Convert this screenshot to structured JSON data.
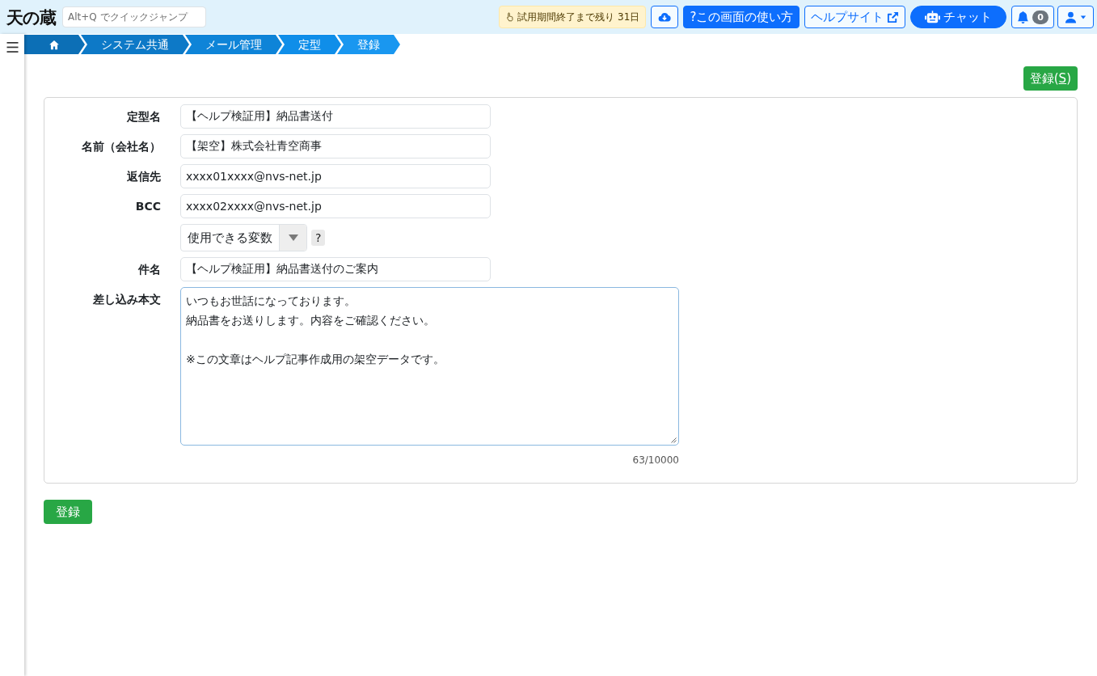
{
  "header": {
    "logo": "天の蔵",
    "quick_jump": {
      "placeholder": "Alt+Q でクイックジャンプ"
    },
    "trial_notice": "試用期間終了まで残り 31日",
    "actions": [
      {
        "kind": "download"
      },
      {
        "kind": "help",
        "label": "?この画面の使い方"
      },
      {
        "kind": "help_site",
        "label": "ヘルプサイト"
      },
      {
        "kind": "chat",
        "label": "チャット"
      },
      {
        "kind": "notifications",
        "count": "0"
      },
      {
        "kind": "user_menu"
      }
    ]
  },
  "breadcrumb": [
    {
      "kind": "home"
    },
    {
      "kind": "link",
      "label": "システム共通"
    },
    {
      "kind": "link",
      "label": "メール管理"
    },
    {
      "kind": "link",
      "label": "定型"
    },
    {
      "kind": "link",
      "label": "登録"
    }
  ],
  "toolbar": {
    "save_button": {
      "label": "登録(",
      "access_key": "S",
      "label_end": ")"
    }
  },
  "form": {
    "fields": [
      {
        "kind": "text",
        "label": "定型名",
        "value": "【ヘルプ検証用】納品書送付"
      },
      {
        "kind": "text",
        "label": "名前（会社名）",
        "value": "【架空】株式会社青空商事"
      },
      {
        "kind": "text",
        "label": "返信先",
        "value": "xxxx01xxxx@nvs-net.jp"
      },
      {
        "kind": "text",
        "label": "BCC",
        "value": "xxxx02xxxx@nvs-net.jp"
      },
      {
        "kind": "select",
        "value": "使用できる変数",
        "help": "?"
      },
      {
        "kind": "text",
        "label": "件名",
        "value": "【ヘルプ検証用】納品書送付のご案内"
      },
      {
        "kind": "textarea",
        "label": "差し込み本文",
        "paragraphs": [
          {
            "lines": [
              "いつもお世話になっております。",
              "納品書をお送りします。内容をご確認ください。"
            ]
          },
          {
            "lines": [
              "※この文章はヘルプ記事作成用の架空データです。"
            ]
          }
        ],
        "counter": "63/10000",
        "focused": true
      }
    ]
  },
  "footer": {
    "submit_button": {
      "label": "登録"
    }
  }
}
